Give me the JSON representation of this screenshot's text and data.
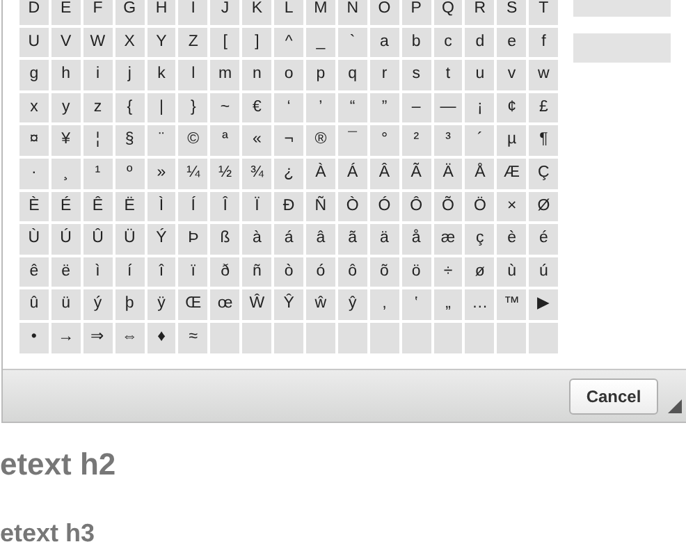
{
  "character_grid": {
    "rows": [
      [
        "D",
        "E",
        "F",
        "G",
        "H",
        "I",
        "J",
        "K",
        "L",
        "M",
        "N",
        "O",
        "P",
        "Q",
        "R",
        "S",
        "T"
      ],
      [
        "U",
        "V",
        "W",
        "X",
        "Y",
        "Z",
        "[",
        "]",
        "^",
        "_",
        "`",
        "a",
        "b",
        "c",
        "d",
        "e",
        "f"
      ],
      [
        "g",
        "h",
        "i",
        "j",
        "k",
        "l",
        "m",
        "n",
        "o",
        "p",
        "q",
        "r",
        "s",
        "t",
        "u",
        "v",
        "w"
      ],
      [
        "x",
        "y",
        "z",
        "{",
        "|",
        "}",
        "~",
        "€",
        "‘",
        "’",
        "“",
        "”",
        "–",
        "—",
        "¡",
        "¢",
        "£"
      ],
      [
        "¤",
        "¥",
        "¦",
        "§",
        "¨",
        "©",
        "ª",
        "«",
        "¬",
        "®",
        "¯",
        "°",
        "²",
        "³",
        "´",
        "µ",
        "¶"
      ],
      [
        "·",
        "¸",
        "¹",
        "º",
        "»",
        "¼",
        "½",
        "¾",
        "¿",
        "À",
        "Á",
        "Â",
        "Ã",
        "Ä",
        "Å",
        "Æ",
        "Ç"
      ],
      [
        "È",
        "É",
        "Ê",
        "Ë",
        "Ì",
        "Í",
        "Î",
        "Ï",
        "Ð",
        "Ñ",
        "Ò",
        "Ó",
        "Ô",
        "Õ",
        "Ö",
        "×",
        "Ø"
      ],
      [
        "Ù",
        "Ú",
        "Û",
        "Ü",
        "Ý",
        "Þ",
        "ß",
        "à",
        "á",
        "â",
        "ã",
        "ä",
        "å",
        "æ",
        "ç",
        "è",
        "é"
      ],
      [
        "ê",
        "ë",
        "ì",
        "í",
        "î",
        "ï",
        "ð",
        "ñ",
        "ò",
        "ó",
        "ô",
        "õ",
        "ö",
        "÷",
        "ø",
        "ù",
        "ú"
      ],
      [
        "û",
        "ü",
        "ý",
        "þ",
        "ÿ",
        "Œ",
        "œ",
        "Ŵ",
        "Ŷ",
        "ŵ",
        "ŷ",
        "‚",
        "‛",
        "„",
        "…",
        "™",
        "▶"
      ],
      [
        "•",
        "→",
        "⇒",
        "⇔",
        "♦",
        "≈"
      ]
    ]
  },
  "dialog_footer": {
    "buttons": [
      "Cancel"
    ]
  },
  "page_headings": [
    {
      "kind": "large",
      "text": "etext h2"
    },
    {
      "kind": "small",
      "text": "etext h3"
    }
  ]
}
